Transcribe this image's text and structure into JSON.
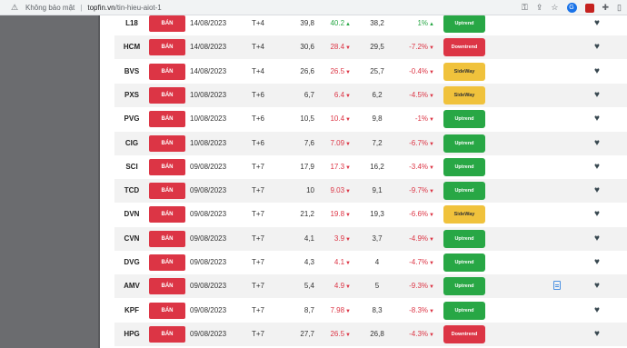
{
  "browser": {
    "security_text": "Không bảo mật",
    "url_host": "topfin.vn",
    "url_path": "/tin-hieu-aiot-1"
  },
  "colors": {
    "sell": "#dc3545",
    "uptrend": "#28a745",
    "downtrend": "#dc3545",
    "sideway": "#f0c23c",
    "positive": "#28a745",
    "negative": "#dc3545"
  },
  "signal_label": "BÁN",
  "rows": [
    {
      "code": "L18",
      "date": "14/08/2023",
      "t": "T+4",
      "buy": "39,8",
      "cur": "40.2",
      "dir": "up",
      "ref": "38,2",
      "pct": "1%",
      "trend": "Uptrend",
      "trend_class": "uptrend",
      "doc": false
    },
    {
      "code": "HCM",
      "date": "14/08/2023",
      "t": "T+4",
      "buy": "30,6",
      "cur": "28.4",
      "dir": "down",
      "ref": "29,5",
      "pct": "-7.2%",
      "trend": "Downtrend",
      "trend_class": "downtrend",
      "doc": false
    },
    {
      "code": "BVS",
      "date": "14/08/2023",
      "t": "T+4",
      "buy": "26,6",
      "cur": "26.5",
      "dir": "down",
      "ref": "25,7",
      "pct": "-0.4%",
      "trend": "SideWay",
      "trend_class": "sideway",
      "doc": false
    },
    {
      "code": "PXS",
      "date": "10/08/2023",
      "t": "T+6",
      "buy": "6,7",
      "cur": "6.4",
      "dir": "down",
      "ref": "6,2",
      "pct": "-4.5%",
      "trend": "SideWay",
      "trend_class": "sideway",
      "doc": false
    },
    {
      "code": "PVG",
      "date": "10/08/2023",
      "t": "T+6",
      "buy": "10,5",
      "cur": "10.4",
      "dir": "down",
      "ref": "9,8",
      "pct": "-1%",
      "trend": "Uptrend",
      "trend_class": "uptrend",
      "doc": false
    },
    {
      "code": "CIG",
      "date": "10/08/2023",
      "t": "T+6",
      "buy": "7,6",
      "cur": "7.09",
      "dir": "down",
      "ref": "7,2",
      "pct": "-6.7%",
      "trend": "Uptrend",
      "trend_class": "uptrend",
      "doc": false
    },
    {
      "code": "SCI",
      "date": "09/08/2023",
      "t": "T+7",
      "buy": "17,9",
      "cur": "17.3",
      "dir": "down",
      "ref": "16,2",
      "pct": "-3.4%",
      "trend": "Uptrend",
      "trend_class": "uptrend",
      "doc": false
    },
    {
      "code": "TCD",
      "date": "09/08/2023",
      "t": "T+7",
      "buy": "10",
      "cur": "9.03",
      "dir": "down",
      "ref": "9,1",
      "pct": "-9.7%",
      "trend": "Uptrend",
      "trend_class": "uptrend",
      "doc": false
    },
    {
      "code": "DVN",
      "date": "09/08/2023",
      "t": "T+7",
      "buy": "21,2",
      "cur": "19.8",
      "dir": "down",
      "ref": "19,3",
      "pct": "-6.6%",
      "trend": "SideWay",
      "trend_class": "sideway",
      "doc": false
    },
    {
      "code": "CVN",
      "date": "09/08/2023",
      "t": "T+7",
      "buy": "4,1",
      "cur": "3.9",
      "dir": "down",
      "ref": "3,7",
      "pct": "-4.9%",
      "trend": "Uptrend",
      "trend_class": "uptrend",
      "doc": false
    },
    {
      "code": "DVG",
      "date": "09/08/2023",
      "t": "T+7",
      "buy": "4,3",
      "cur": "4.1",
      "dir": "down",
      "ref": "4",
      "pct": "-4.7%",
      "trend": "Uptrend",
      "trend_class": "uptrend",
      "doc": false
    },
    {
      "code": "AMV",
      "date": "09/08/2023",
      "t": "T+7",
      "buy": "5,4",
      "cur": "4.9",
      "dir": "down",
      "ref": "5",
      "pct": "-9.3%",
      "trend": "Uptrend",
      "trend_class": "uptrend",
      "doc": true
    },
    {
      "code": "KPF",
      "date": "09/08/2023",
      "t": "T+7",
      "buy": "8,7",
      "cur": "7.98",
      "dir": "down",
      "ref": "8,3",
      "pct": "-8.3%",
      "trend": "Uptrend",
      "trend_class": "uptrend",
      "doc": false
    },
    {
      "code": "HPG",
      "date": "09/08/2023",
      "t": "T+7",
      "buy": "27,7",
      "cur": "26.5",
      "dir": "down",
      "ref": "26,8",
      "pct": "-4.3%",
      "trend": "Downtrend",
      "trend_class": "downtrend",
      "doc": false
    }
  ]
}
